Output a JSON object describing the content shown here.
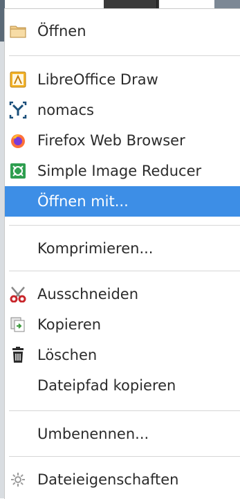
{
  "menu": {
    "items": [
      {
        "label": "Öffnen",
        "icon": "folder-icon"
      },
      {
        "label": "LibreOffice Draw",
        "icon": "libreoffice-draw-icon"
      },
      {
        "label": "nomacs",
        "icon": "nomacs-icon"
      },
      {
        "label": "Firefox Web Browser",
        "icon": "firefox-icon"
      },
      {
        "label": "Simple Image Reducer",
        "icon": "image-reducer-icon"
      },
      {
        "label": "Öffnen mit...",
        "icon": ""
      },
      {
        "label": "Komprimieren...",
        "icon": ""
      },
      {
        "label": "Ausschneiden",
        "icon": "scissors-icon"
      },
      {
        "label": "Kopieren",
        "icon": "copy-icon"
      },
      {
        "label": "Löschen",
        "icon": "trash-icon"
      },
      {
        "label": "Dateipfad kopieren",
        "icon": ""
      },
      {
        "label": "Umbenennen...",
        "icon": ""
      },
      {
        "label": "Dateieigenschaften",
        "icon": "gear-icon"
      }
    ],
    "highlighted_index": 5
  },
  "colors": {
    "highlight": "#3d8ee6",
    "text": "#2b2b2b",
    "separator": "#d6d6d6"
  }
}
